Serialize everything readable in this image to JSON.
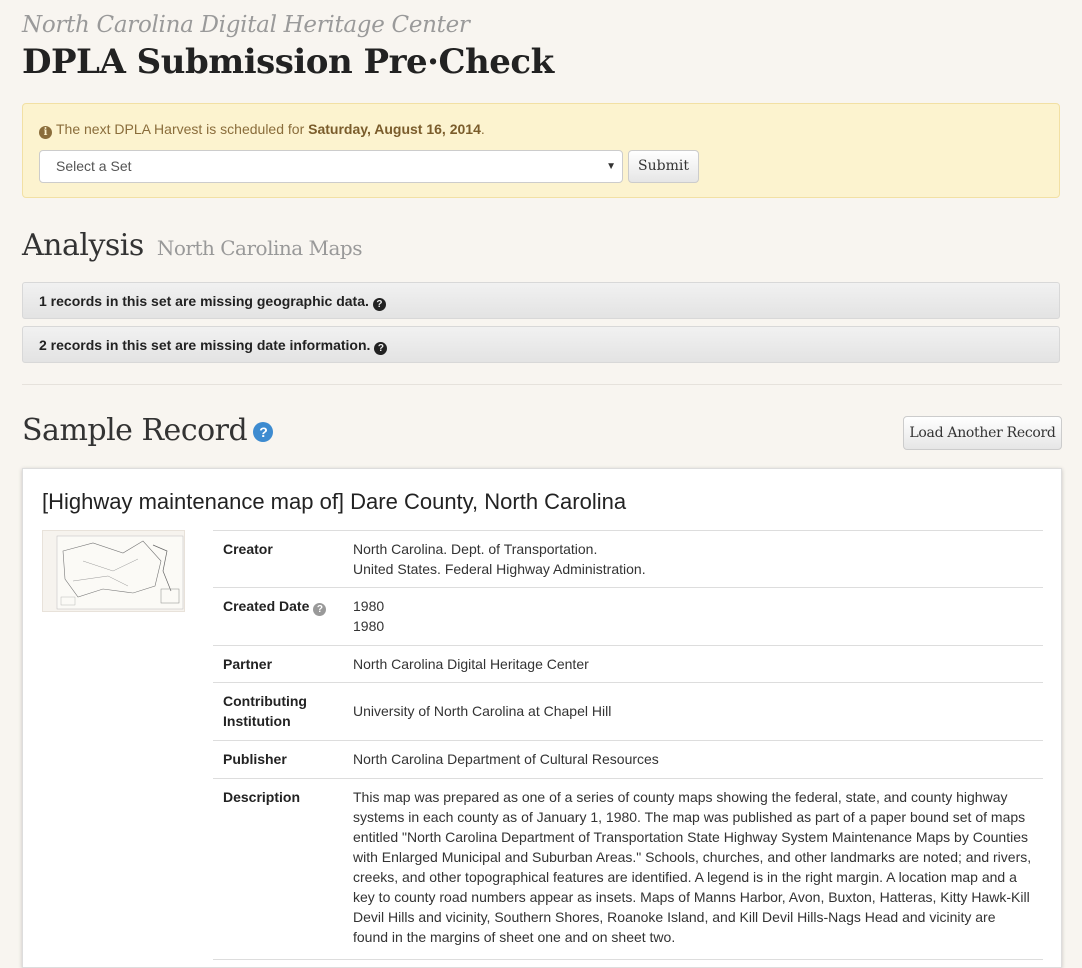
{
  "header": {
    "org": "North Carolina Digital Heritage Center",
    "title": "DPLA Submission Pre·Check"
  },
  "alert": {
    "prefix": "The next DPLA Harvest is scheduled for ",
    "date": "Saturday, August 16, 2014",
    "suffix": "."
  },
  "form": {
    "select_value": "Select a Set",
    "submit_label": "Submit"
  },
  "analysis": {
    "heading": "Analysis",
    "set_name": "North Carolina Maps",
    "items": [
      "1 records in this set are missing geographic data.",
      "2 records in this set are missing date information."
    ]
  },
  "sample": {
    "heading": "Sample Record",
    "load_label": "Load Another Record"
  },
  "record": {
    "title": "[Highway maintenance map of] Dare County, North Carolina",
    "creator_label": "Creator",
    "creator": [
      "North Carolina. Dept. of Transportation.",
      "United States. Federal Highway Administration."
    ],
    "date_label": "Created Date",
    "date": [
      "1980",
      "1980"
    ],
    "partner_label": "Partner",
    "partner": "North Carolina Digital Heritage Center",
    "institution_label": "Contributing Institution",
    "institution": "University of North Carolina at Chapel Hill",
    "publisher_label": "Publisher",
    "publisher": "North Carolina Department of Cultural Resources",
    "description_label": "Description",
    "description": "This map was prepared as one of a series of county maps showing the federal, state, and county highway systems in each county as of January 1, 1980. The map was published as part of a paper bound set of maps entitled \"North Carolina Department of Transportation State Highway System Maintenance Maps by Counties with Enlarged Municipal and Suburban Areas.\" Schools, churches, and other landmarks are noted; and rivers, creeks, and other topographical features are identified. A legend is in the right margin. A location map and a key to county road numbers appear as insets. Maps of Manns Harbor, Avon, Buxton, Hatteras, Kitty Hawk-Kill Devil Hills and vicinity, Southern Shores, Roanoke Island, and Kill Devil Hills-Nags Head and vicinity are found in the margins of sheet one and on sheet two."
  }
}
